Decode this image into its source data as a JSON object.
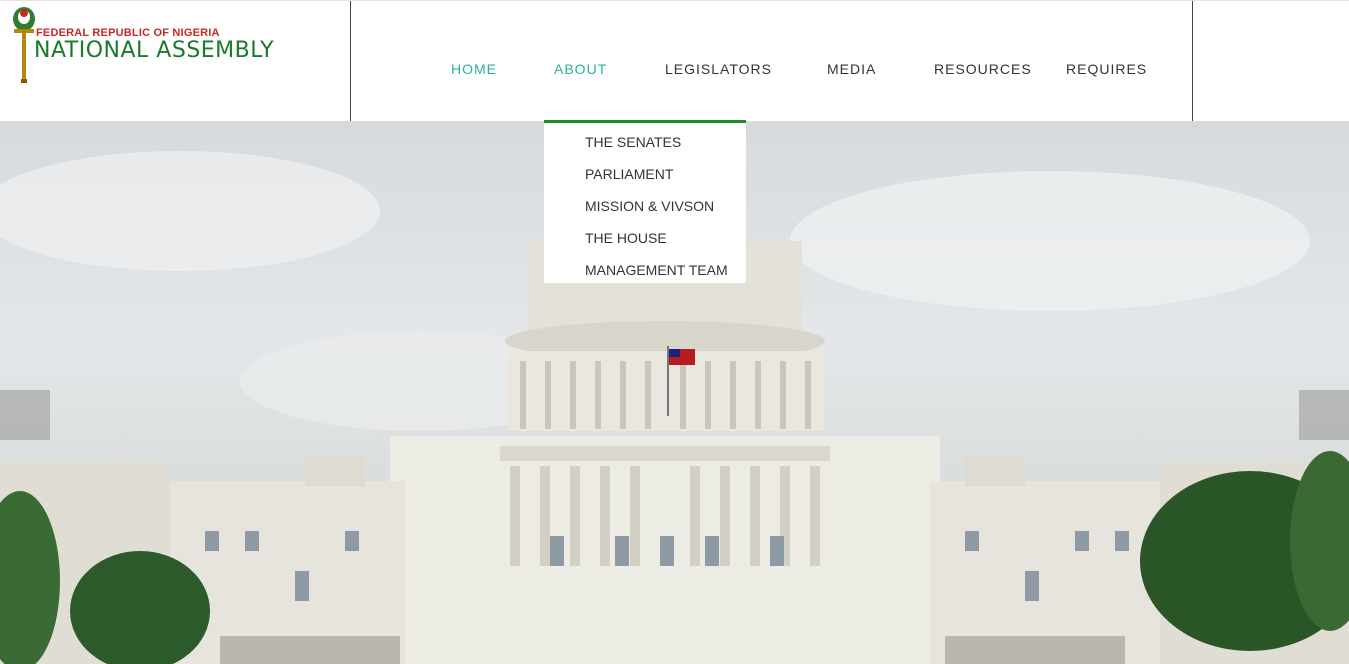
{
  "logo": {
    "top_line": "FEDERAL REPUBLIC OF NIGERIA",
    "main_line": "NATIONAL ASSEMBLY"
  },
  "nav": {
    "items": [
      {
        "label": "HOME"
      },
      {
        "label": "ABOUT"
      },
      {
        "label": "LEGISLATORS"
      },
      {
        "label": "MEDIA"
      },
      {
        "label": "RESOURCES"
      },
      {
        "label": "REQUIRES"
      }
    ],
    "active": "HOME",
    "open_menu": "ABOUT"
  },
  "about_menu": {
    "items": [
      {
        "label": "THE SENATES"
      },
      {
        "label": "PARLIAMENT"
      },
      {
        "label": "MISSION & VIVSON"
      },
      {
        "label": "THE HOUSE"
      },
      {
        "label": "MANAGEMENT TEAM"
      }
    ]
  },
  "slider": {
    "prev_icon": "chevron-left-icon",
    "next_icon": "chevron-right-icon"
  },
  "colors": {
    "accent": "#2ab19b",
    "dropdown_border": "#1e8a2c",
    "logo_green": "#1a7a2b",
    "logo_red": "#c62828"
  }
}
